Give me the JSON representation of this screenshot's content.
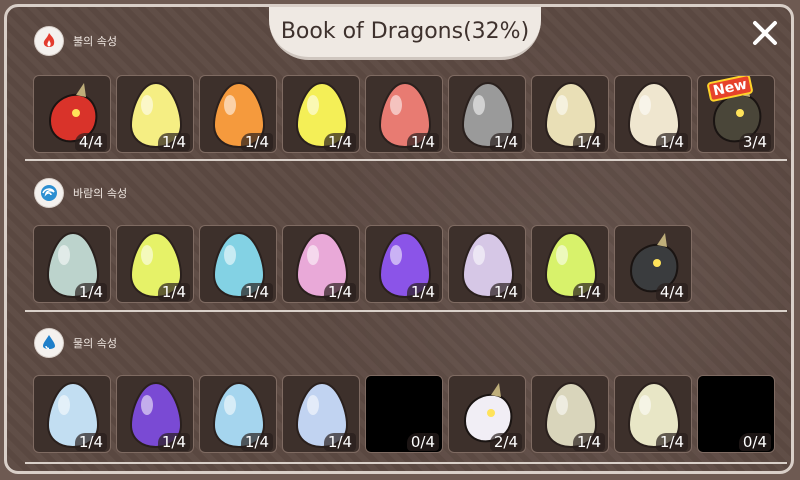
{
  "header": {
    "title": "Book of Dragons(32%)"
  },
  "sections": [
    {
      "label": "불의 속성",
      "icon": "fire-icon",
      "slots": [
        {
          "name": "red-dragon",
          "count": "4/4",
          "kind": "dragon",
          "color": "#d9332a"
        },
        {
          "name": "yellow-egg",
          "count": "1/4",
          "kind": "egg",
          "color": "#f5ee83"
        },
        {
          "name": "orange-spotted-egg",
          "count": "1/4",
          "kind": "egg",
          "color": "#f59a3d"
        },
        {
          "name": "yellow-bright-egg",
          "count": "1/4",
          "kind": "egg",
          "color": "#f4ef57"
        },
        {
          "name": "red-pink-egg",
          "count": "1/4",
          "kind": "egg",
          "color": "#e87b72"
        },
        {
          "name": "gray-spiky-egg",
          "count": "1/4",
          "kind": "egg",
          "color": "#9a9a9a"
        },
        {
          "name": "cream-striped-egg",
          "count": "1/4",
          "kind": "egg",
          "color": "#e9dfb6"
        },
        {
          "name": "cream-purple-spotted-egg",
          "count": "1/4",
          "kind": "egg",
          "color": "#efe6cf"
        },
        {
          "name": "new-dark-dragon",
          "count": "3/4",
          "kind": "dragon",
          "color": "#4a4639",
          "badge": "New"
        }
      ]
    },
    {
      "label": "바람의 속성",
      "icon": "wind-icon",
      "slots": [
        {
          "name": "pale-green-egg",
          "count": "1/4",
          "kind": "egg",
          "color": "#bcd3cc"
        },
        {
          "name": "lime-egg",
          "count": "1/4",
          "kind": "egg",
          "color": "#e6f268"
        },
        {
          "name": "cyan-egg",
          "count": "1/4",
          "kind": "egg",
          "color": "#83d2e4"
        },
        {
          "name": "pink-egg",
          "count": "1/4",
          "kind": "egg",
          "color": "#e9a9d8"
        },
        {
          "name": "purple-ringed-egg",
          "count": "1/4",
          "kind": "egg",
          "color": "#8b54e8"
        },
        {
          "name": "lavender-spotted-egg",
          "count": "1/4",
          "kind": "egg",
          "color": "#d6c7e6"
        },
        {
          "name": "yellow-green-egg",
          "count": "1/4",
          "kind": "egg",
          "color": "#d8f26b"
        },
        {
          "name": "dark-wind-dragon",
          "count": "4/4",
          "kind": "dragon",
          "color": "#3a3c3e"
        }
      ]
    },
    {
      "label": "물의 속성",
      "icon": "water-drop-icon",
      "slots": [
        {
          "name": "light-blue-egg",
          "count": "1/4",
          "kind": "egg",
          "color": "#c2def2"
        },
        {
          "name": "violet-egg",
          "count": "1/4",
          "kind": "egg",
          "color": "#7a4ad4"
        },
        {
          "name": "sky-egg",
          "count": "1/4",
          "kind": "egg",
          "color": "#a5d5ee"
        },
        {
          "name": "periwinkle-egg",
          "count": "1/4",
          "kind": "egg",
          "color": "#c1d3f1"
        },
        {
          "name": "locked-silhouette-1",
          "count": "0/4",
          "kind": "silhouette",
          "color": "#000000"
        },
        {
          "name": "white-water-dragon",
          "count": "2/4",
          "kind": "dragon",
          "color": "#f1eef5"
        },
        {
          "name": "beige-green-egg",
          "count": "1/4",
          "kind": "egg",
          "color": "#d9d5bb"
        },
        {
          "name": "cream-green-egg",
          "count": "1/4",
          "kind": "egg",
          "color": "#e8e6c6"
        },
        {
          "name": "locked-silhouette-2",
          "count": "0/4",
          "kind": "silhouette",
          "color": "#000000"
        }
      ]
    }
  ]
}
